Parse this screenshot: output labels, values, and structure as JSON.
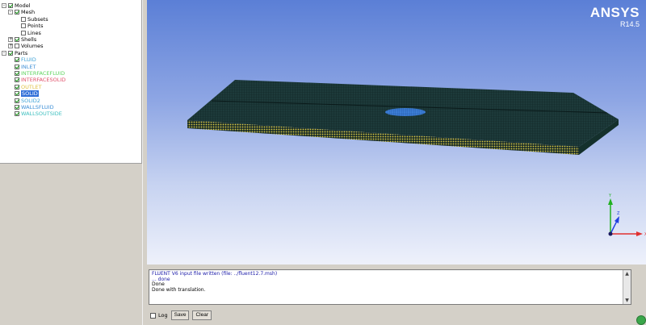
{
  "tree": [
    {
      "label": "Model",
      "checked": true,
      "color": "#000000"
    },
    {
      "label": "Mesh",
      "checked": true,
      "color": "#000000"
    },
    {
      "label": "Subsets",
      "checked": false,
      "color": "#000000"
    },
    {
      "label": "Points",
      "checked": false,
      "color": "#000000"
    },
    {
      "label": "Lines",
      "checked": false,
      "color": "#000000"
    },
    {
      "label": "Shells",
      "checked": true,
      "color": "#000000"
    },
    {
      "label": "Volumes",
      "checked": false,
      "color": "#000000"
    },
    {
      "label": "Parts",
      "checked": true,
      "color": "#000000"
    },
    {
      "label": "FLUID",
      "checked": true,
      "color": "#3da1d6"
    },
    {
      "label": "INLET",
      "checked": true,
      "color": "#3d8fd6"
    },
    {
      "label": "INTERFACEFLUID",
      "checked": true,
      "color": "#5fd35f"
    },
    {
      "label": "INTERFACESOLID",
      "checked": true,
      "color": "#e0506a"
    },
    {
      "label": "OUTLET",
      "checked": true,
      "color": "#e0c040"
    },
    {
      "label": "SOLID",
      "checked": true,
      "color": "#ffffff",
      "selected": true
    },
    {
      "label": "SOLID2",
      "checked": true,
      "color": "#3da1d6"
    },
    {
      "label": "WALLSFLUID",
      "checked": true,
      "color": "#3d8fd6"
    },
    {
      "label": "WALLSOUTSIDE",
      "checked": true,
      "color": "#3dbfbf"
    }
  ],
  "viewport": {
    "brand": "ANSYS",
    "version": "R14.5"
  },
  "console": {
    "lines": [
      {
        "text": "FLUENT V6 input file written (file: ../fluent12.7.msh)",
        "color": "#1a1aa8"
      },
      {
        "text": "... done",
        "color": "#1a1aa8"
      },
      {
        "text": "Done",
        "color": "#000000"
      },
      {
        "text": "Done with translation.",
        "color": "#000000"
      }
    ],
    "log_label": "Log",
    "save_label": "Save",
    "clear_label": "Clear"
  },
  "axes": {
    "x": "X",
    "y": "Y",
    "z": "Z",
    "x_color": "#e03030",
    "y_color": "#20b020",
    "z_color": "#2040e0"
  }
}
